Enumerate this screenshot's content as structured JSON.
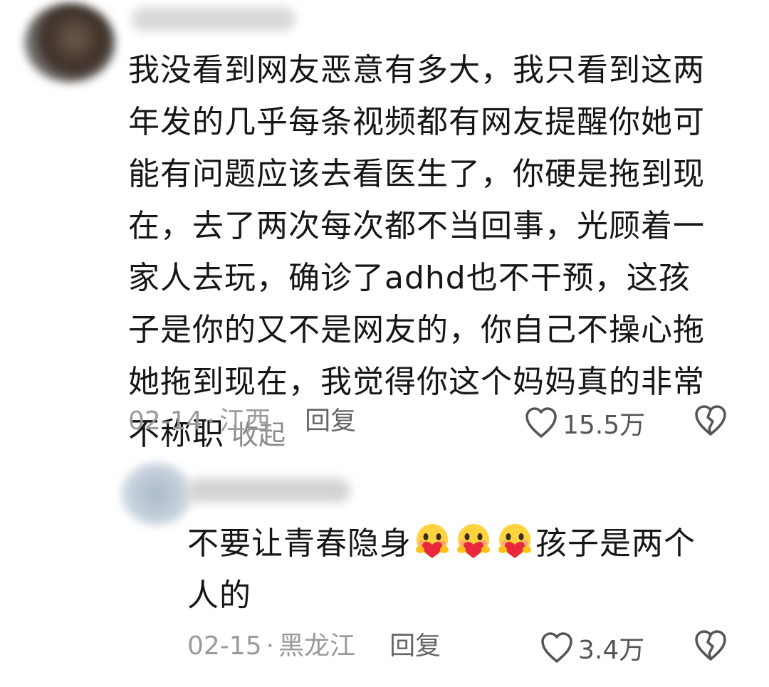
{
  "comments": [
    {
      "text": "我没看到网友恶意有多大，我只看到这两年发的几乎每条视频都有网友提醒你她可能有问题应该去看医生了，你硬是拖到现在，去了两次每次都不当回事，光顾着一家人去玩，确诊了adhd也不干预，这孩子是你的又不是网友的，你自己不操心拖她拖到现在，我觉得你这个妈妈真的非常不称职",
      "collapse_label": "收起",
      "date": "02-14",
      "location": "江西",
      "reply_label": "回复",
      "like_count": "15.5万"
    },
    {
      "text_before": "不要让青春隐身",
      "emoji_icon": "heart-hug-emoji",
      "text_after": "孩子是两个人的",
      "date": "02-15",
      "location": "黑龙江",
      "reply_label": "回复",
      "like_count": "3.4万"
    }
  ],
  "separator": "·",
  "icons": {
    "like": "heart-outline-icon",
    "dislike": "broken-heart-icon"
  },
  "colors": {
    "text": "#161616",
    "meta": "#9a9a9a",
    "icon": "#555555"
  }
}
